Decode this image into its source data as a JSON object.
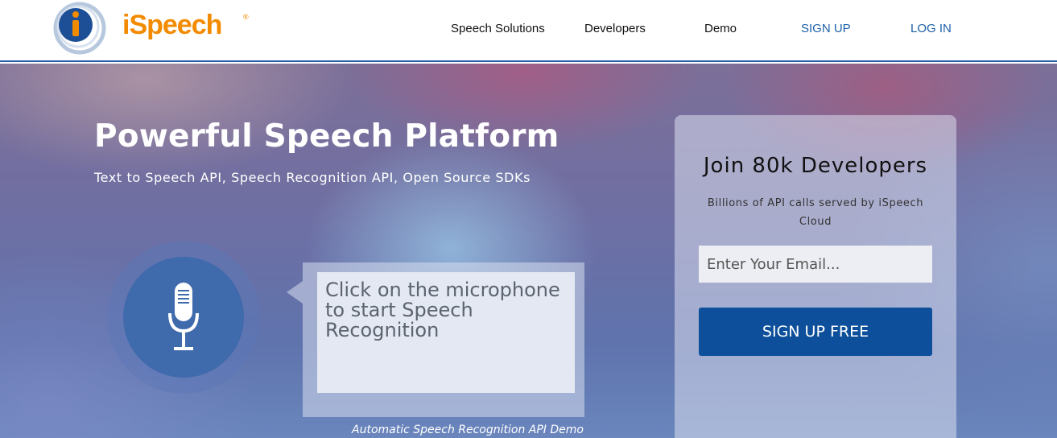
{
  "header": {
    "logo_text": "iSpeech",
    "logo_registered": "®",
    "nav": {
      "speech_solutions": "Speech Solutions",
      "developers": "Developers",
      "demo": "Demo",
      "sign_up": "SIGN UP",
      "log_in": "LOG IN"
    }
  },
  "hero": {
    "title": "Powerful Speech Platform",
    "subtitle": "Text to Speech API, Speech Recognition API, Open Source SDKs",
    "mic_prompt": "Click on the microphone to start Speech Recognition",
    "demo_caption": "Automatic Speech Recognition API Demo"
  },
  "signup": {
    "title": "Join 80k Developers",
    "subtitle": "Billions of API calls served by iSpeech Cloud",
    "email_placeholder": "Enter Your Email...",
    "button_label": "SIGN UP FREE"
  },
  "colors": {
    "brand_orange": "#f28b00",
    "brand_blue": "#0d4f9a",
    "nav_link_blue": "#1c5fa8"
  },
  "icons": {
    "logo": "ispeech-logo-icon",
    "microphone": "microphone-icon"
  }
}
